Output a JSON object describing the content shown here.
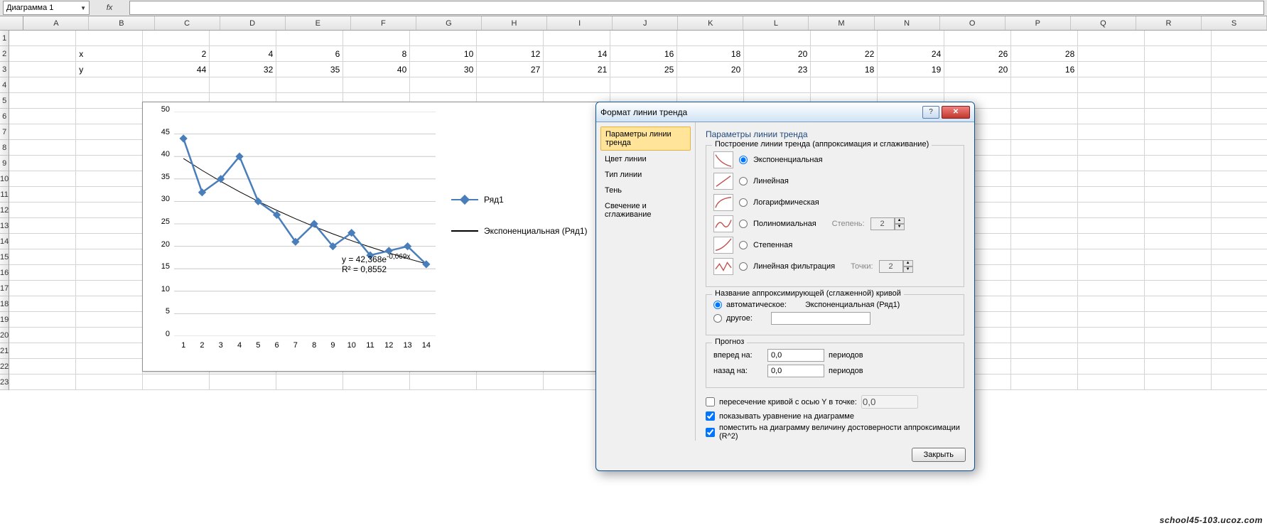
{
  "formula_bar": {
    "name_box": "Диаграмма 1",
    "fx": "fx",
    "formula": ""
  },
  "columns": [
    "A",
    "B",
    "C",
    "D",
    "E",
    "F",
    "G",
    "H",
    "I",
    "J",
    "K",
    "L",
    "M",
    "N",
    "O",
    "P",
    "Q",
    "R",
    "S"
  ],
  "row_numbers": [
    1,
    2,
    3,
    4,
    5,
    6,
    7,
    8,
    9,
    10,
    11,
    12,
    13,
    14,
    15,
    16,
    17,
    18,
    19,
    20,
    21,
    22,
    23
  ],
  "sheet": {
    "row2": {
      "label": "x",
      "values": [
        2,
        4,
        6,
        8,
        10,
        12,
        14,
        16,
        18,
        20,
        22,
        24,
        26,
        28
      ]
    },
    "row3": {
      "label": "y",
      "values": [
        44,
        32,
        35,
        40,
        30,
        27,
        21,
        25,
        20,
        23,
        18,
        19,
        20,
        16
      ]
    }
  },
  "chart_data": {
    "type": "line",
    "x": [
      1,
      2,
      3,
      4,
      5,
      6,
      7,
      8,
      9,
      10,
      11,
      12,
      13,
      14
    ],
    "series": [
      {
        "name": "Ряд1",
        "values": [
          44,
          32,
          35,
          40,
          30,
          27,
          21,
          25,
          20,
          23,
          18,
          19,
          20,
          16
        ]
      }
    ],
    "trendline": {
      "type": "exponential",
      "equation": "y = 42,368e",
      "exponent": "-0,069x",
      "r2": "R² = 0,8552",
      "legend": "Экспоненциальная (Ряд1)"
    },
    "ylim": [
      0,
      50
    ],
    "yticks": [
      0,
      5,
      10,
      15,
      20,
      25,
      30,
      35,
      40,
      45,
      50
    ],
    "xticks": [
      1,
      2,
      3,
      4,
      5,
      6,
      7,
      8,
      9,
      10,
      11,
      12,
      13,
      14
    ]
  },
  "legend": {
    "series": "Ряд1",
    "trend": "Экспоненциальная (Ряд1)"
  },
  "dialog": {
    "title": "Формат линии тренда",
    "nav": [
      "Параметры линии тренда",
      "Цвет линии",
      "Тип линии",
      "Тень",
      "Свечение и сглаживание"
    ],
    "heading": "Параметры линии тренда",
    "group_build": "Построение линии тренда (аппроксимация и сглаживание)",
    "opts": {
      "exp": "Экспоненциальная",
      "lin": "Линейная",
      "log": "Логарифмическая",
      "poly": "Полиномиальная",
      "pow": "Степенная",
      "ma": "Линейная фильтрация"
    },
    "degree_label": "Степень:",
    "degree_val": "2",
    "points_label": "Точки:",
    "points_val": "2",
    "group_name": "Название аппроксимирующей (сглаженной) кривой",
    "name_auto": "автоматическое:",
    "name_auto_val": "Экспоненциальная (Ряд1)",
    "name_other": "другое:",
    "group_forecast": "Прогноз",
    "fwd_label": "вперед на:",
    "fwd_val": "0,0",
    "periods": "периодов",
    "back_label": "назад на:",
    "back_val": "0,0",
    "intercept": "пересечение кривой с осью Y в точке:",
    "intercept_val": "0,0",
    "show_eq": "показывать уравнение на диаграмме",
    "show_r2": "поместить на диаграмму величину достоверности аппроксимации (R^2)",
    "close": "Закрыть"
  },
  "watermark": "school45-103.ucoz.com"
}
